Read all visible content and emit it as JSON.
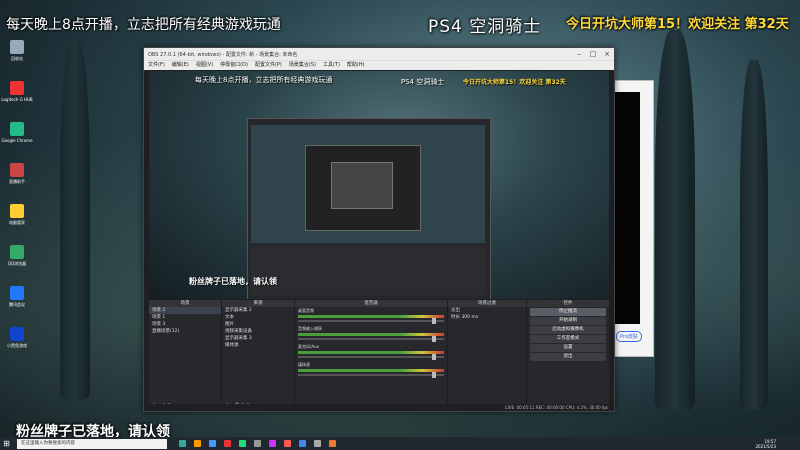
{
  "overlay": {
    "top_left": "每天晚上8点开播，立志把所有经典游戏玩通",
    "top_center": "PS4 空洞骑士",
    "top_right": "今日开坑大师第15！欢迎关注 第32天",
    "bottom_left": "粉丝牌子已落地，请认领"
  },
  "desktop_icons": [
    {
      "label": "回收站",
      "color": "#9ab"
    },
    {
      "label": "Logitech G HUB",
      "color": "#e33"
    },
    {
      "label": "Google Chrome",
      "color": "#2b8"
    },
    {
      "label": "直播助手",
      "color": "#c44"
    },
    {
      "label": "电脑管家",
      "color": "#fc3"
    },
    {
      "label": "QQ浏览器",
      "color": "#3a6"
    },
    {
      "label": "腾讯会议",
      "color": "#27f"
    },
    {
      "label": "小黑鱼游戏",
      "color": "#14c"
    }
  ],
  "obs": {
    "title": "OBS 27.0.1 (64-bit, windows) - 配置文件: 新 - 场景集合: 未命名",
    "menu": [
      "文件(F)",
      "编辑(E)",
      "视图(V)",
      "停靠窗口(D)",
      "配置文件(P)",
      "场景集合(S)",
      "工具(T)",
      "帮助(H)"
    ],
    "docks": {
      "scenes": {
        "header": "场景",
        "items": [
          "场景 2",
          "场景 1",
          "场景 3",
          "直播场景(12)"
        ],
        "selected": 0
      },
      "sources": {
        "header": "来源",
        "items": [
          "显示器采集 2",
          "文本",
          "图片",
          "视频采集设备",
          "显示器采集 3",
          "媒体源"
        ]
      },
      "mixer": {
        "header": "混音器",
        "tracks": [
          {
            "name": "桌面音频",
            "level": "0.0 dB",
            "fader": 0.92
          },
          {
            "name": "音频输入捕获",
            "level": "0.0 dB",
            "fader": 0.92
          },
          {
            "name": "麦克风/Aux",
            "level": "0.0 dB",
            "fader": 0.92
          },
          {
            "name": "媒体源",
            "level": "0.0 dB",
            "fader": 0.92
          }
        ]
      },
      "transitions": {
        "header": "场景过渡",
        "type": "淡出",
        "duration_label": "时长",
        "duration": "300 ms"
      },
      "controls": {
        "header": "控件",
        "buttons": [
          "停止推流",
          "开始录制",
          "启动虚拟摄像机",
          "工作室模式",
          "设置",
          "退出"
        ]
      }
    },
    "status": "LIVE: 00:05:11  REC: 00:00:00  CPU: 4.2%, 30.00 fps"
  },
  "side_dialog": {
    "chip": "Pro皮肤"
  },
  "taskbar": {
    "search_placeholder": "在这里输入你要搜索的内容",
    "time": "19:57",
    "date": "2021/5/23",
    "icon_colors": [
      "#3a9",
      "#f90",
      "#49f",
      "#e33",
      "#2d7",
      "#999",
      "#c3f",
      "#f55",
      "#48e",
      "#aaa",
      "#e73"
    ]
  }
}
